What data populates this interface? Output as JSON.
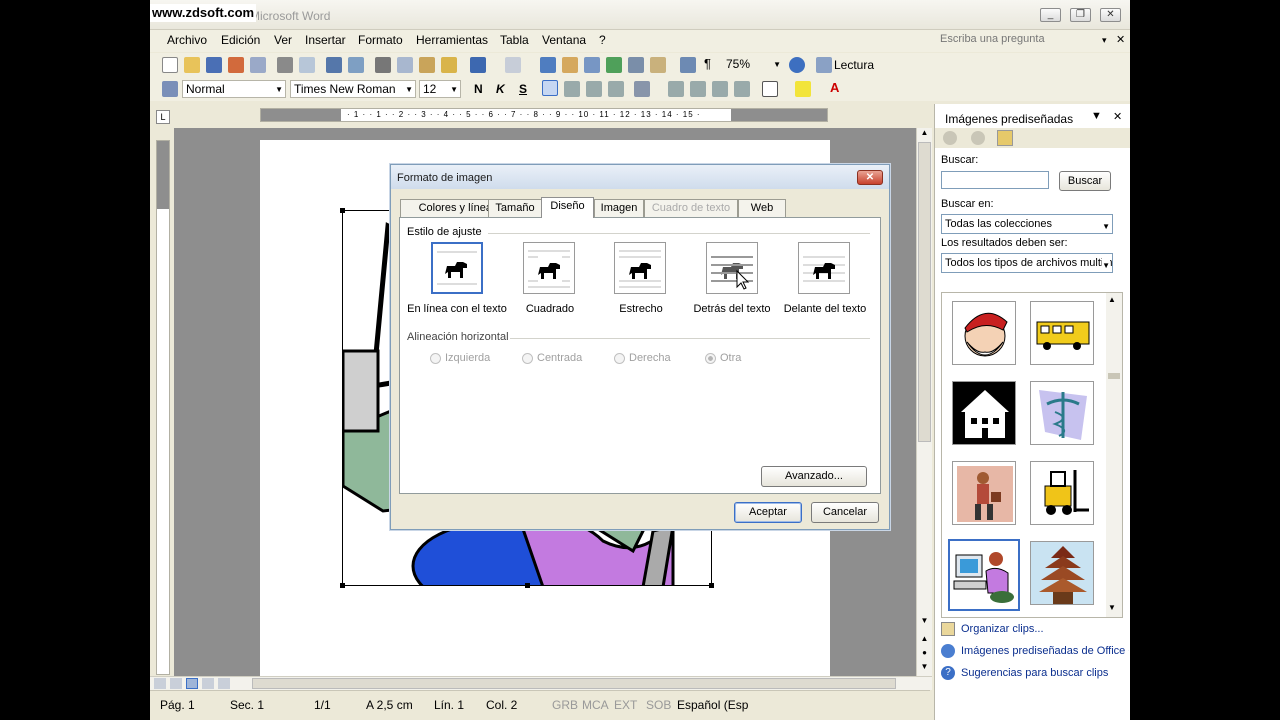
{
  "watermark": "www.zdsoft.com",
  "window": {
    "title": "Microsoft Word",
    "minimize": "_",
    "restore": "❐",
    "close": "✕"
  },
  "menu": [
    "Archivo",
    "Edición",
    "Ver",
    "Insertar",
    "Formato",
    "Herramientas",
    "Tabla",
    "Ventana",
    "?"
  ],
  "ask_placeholder": "Escriba una pregunta",
  "toolbar": {
    "zoom": "75%",
    "read_label": "Lectura"
  },
  "formatting": {
    "style": "Normal",
    "font": "Times New Roman",
    "size": "12",
    "bold": "N",
    "italic": "K",
    "underline": "S"
  },
  "ruler_numbers": [
    "1",
    "2",
    "1",
    "1",
    "2",
    "3",
    "4",
    "5",
    "6",
    "7",
    "8",
    "9",
    "10",
    "11",
    "12",
    "13",
    "14",
    "15",
    "16",
    "17"
  ],
  "status": {
    "page": "Pág. 1",
    "section": "Sec. 1",
    "pages": "1/1",
    "at": "A 2,5 cm",
    "line": "Lín. 1",
    "col": "Col. 2",
    "grb": "GRB",
    "mca": "MCA",
    "ext": "EXT",
    "sob": "SOB",
    "lang": "Español (Esp"
  },
  "taskpane": {
    "title": "Imágenes prediseñadas",
    "search_label": "Buscar:",
    "search_value": "",
    "search_button": "Buscar",
    "search_in_label": "Buscar en:",
    "search_in_value": "Todas las colecciones",
    "results_label": "Los resultados deben ser:",
    "results_value": "Todos los tipos de archivos multim",
    "clips": [
      "Santa Claus",
      "Autobús escolar",
      "Edificio",
      "Caduceo",
      "Mujer con bolso",
      "Carretilla elevadora",
      "Persona en computadora",
      "Pagoda"
    ],
    "links": [
      "Organizar clips...",
      "Imágenes prediseñadas de Office O",
      "Sugerencias para buscar clips"
    ]
  },
  "dialog": {
    "title": "Formato de imagen",
    "tabs": [
      {
        "label": "Colores y líneas"
      },
      {
        "label": "Tamaño"
      },
      {
        "label": "Diseño"
      },
      {
        "label": "Imagen"
      },
      {
        "label": "Cuadro de texto"
      },
      {
        "label": "Web"
      }
    ],
    "active_tab": "Diseño",
    "wrap_section": "Estilo de ajuste",
    "wrap_options": [
      "En línea con el texto",
      "Cuadrado",
      "Estrecho",
      "Detrás del texto",
      "Delante del texto"
    ],
    "align_section": "Alineación horizontal",
    "align_options": [
      "Izquierda",
      "Centrada",
      "Derecha",
      "Otra"
    ],
    "advanced_button": "Avanzado...",
    "ok_button": "Aceptar",
    "cancel_button": "Cancelar"
  },
  "colors": {
    "accent": "#3b6fc6",
    "link": "#0b2f8f"
  }
}
